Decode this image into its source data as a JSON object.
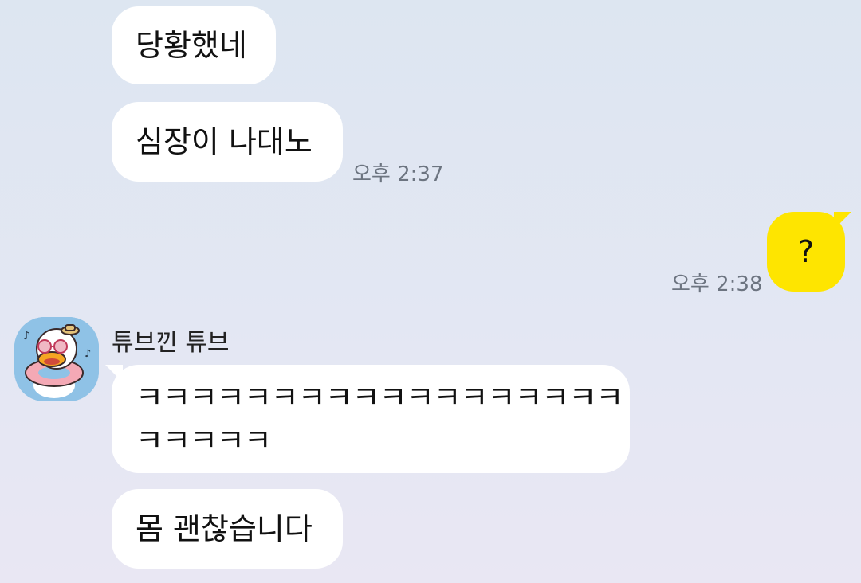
{
  "messages": {
    "m1": "당황했네",
    "m2": "심장이 나대노",
    "time1": "오후 2:37",
    "me1": "?",
    "time2": "오후 2:38",
    "sender_name": "튜브낀 튜브",
    "m3_line1": "ㅋㅋㅋㅋㅋㅋㅋㅋㅋㅋㅋㅋㅋㅋㅋㅋㅋㅋ",
    "m3_line2": "ㅋㅋㅋㅋㅋ",
    "m4": "몸 괜찮습니다"
  },
  "colors": {
    "my_bubble": "#fee500",
    "their_bubble": "#ffffff",
    "time_text": "#6c7480"
  },
  "icons": {
    "avatar": "duck-with-tube-avatar-icon"
  }
}
